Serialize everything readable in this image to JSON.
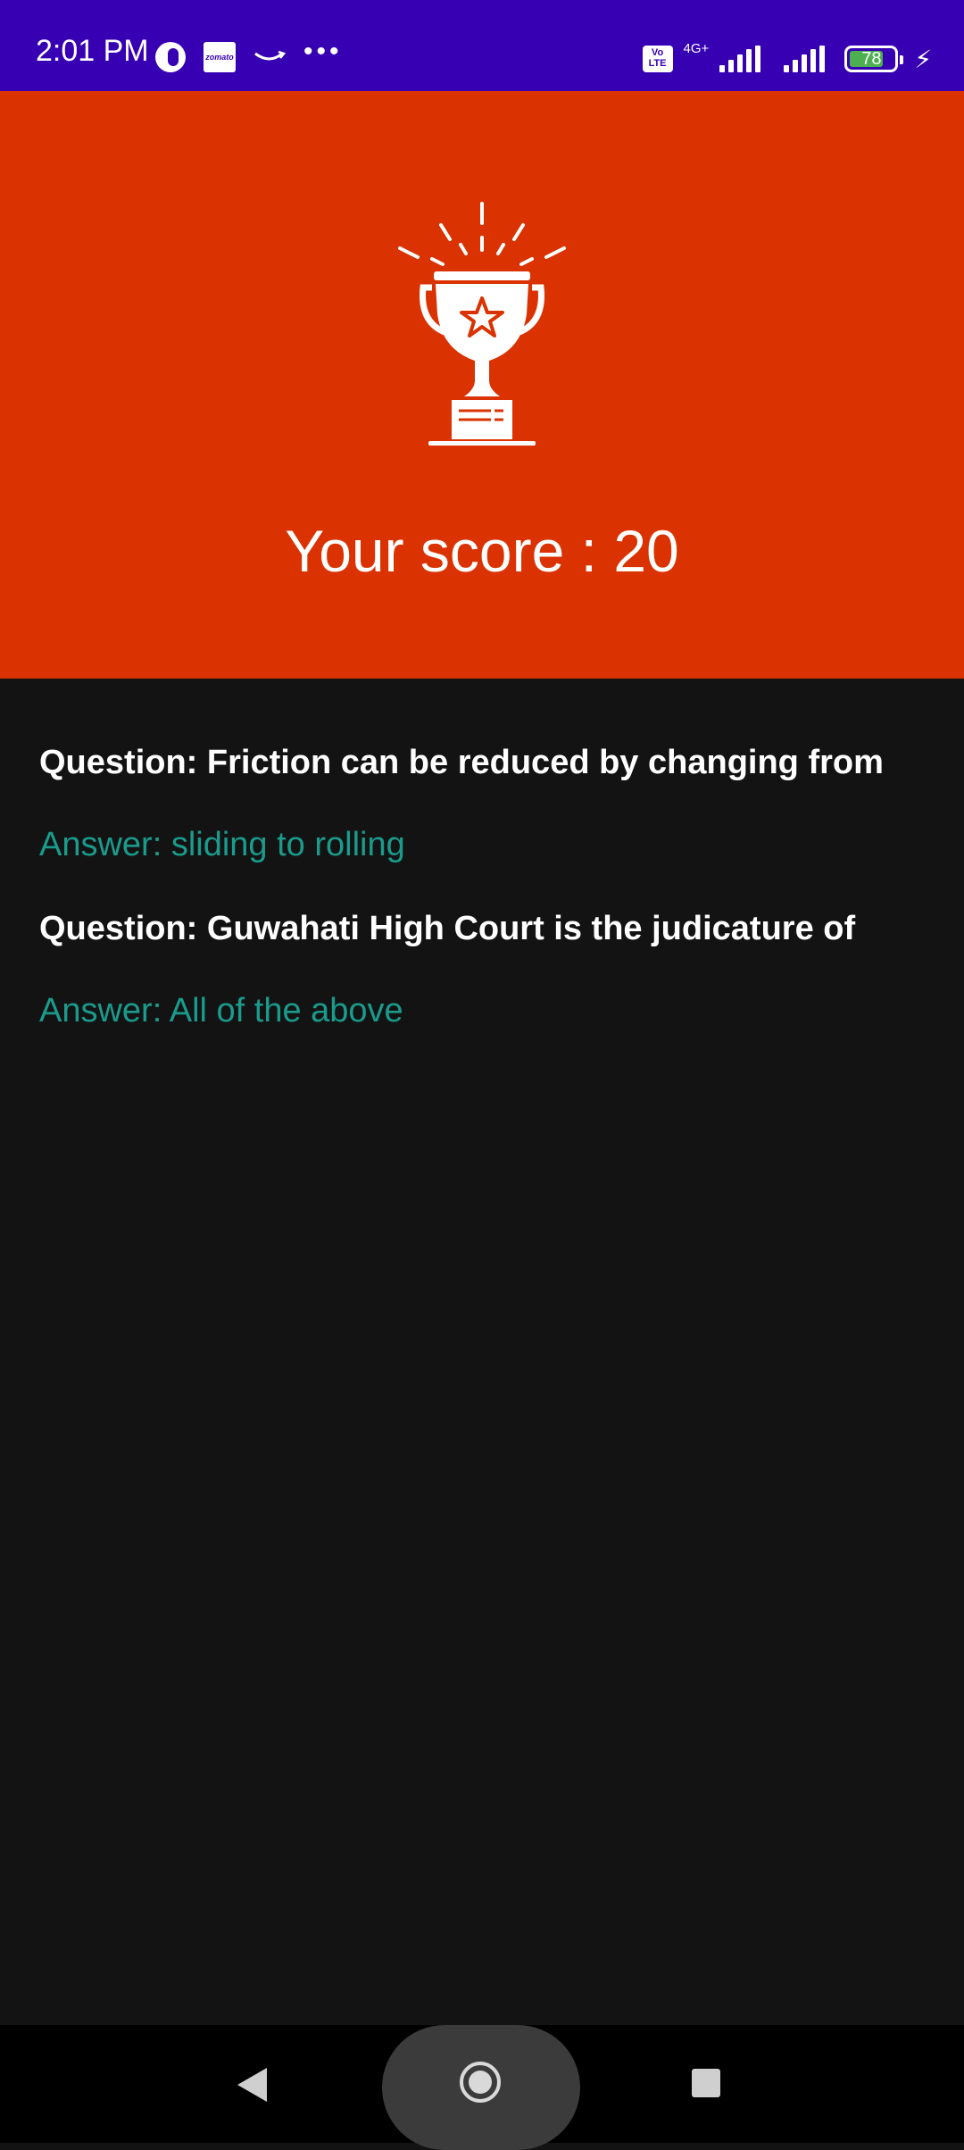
{
  "status_bar": {
    "time": "2:01 PM",
    "app_icon_label": "zomato",
    "more_notifications": "•••",
    "volte_label": "Vo\nLTE",
    "network_type": "4G+",
    "battery_level": "78",
    "battery_fraction": 0.78,
    "background_color": "#3700b3"
  },
  "header": {
    "background_color": "#da3200",
    "trophy_icon": "trophy-icon",
    "score_text": "Your score : 20"
  },
  "results": [
    {
      "question": "Question: Friction can be reduced by changing from",
      "answer": "Answer: sliding to rolling"
    },
    {
      "question": "Question: Guwahati High Court is the judicature of",
      "answer": "Answer: All of the above"
    }
  ],
  "colors": {
    "answer_text": "#1a9b8c",
    "page_background": "#131313"
  },
  "nav_bar": {
    "back_icon": "back-triangle-icon",
    "home_icon": "home-circle-icon",
    "recents_icon": "recents-square-icon"
  }
}
